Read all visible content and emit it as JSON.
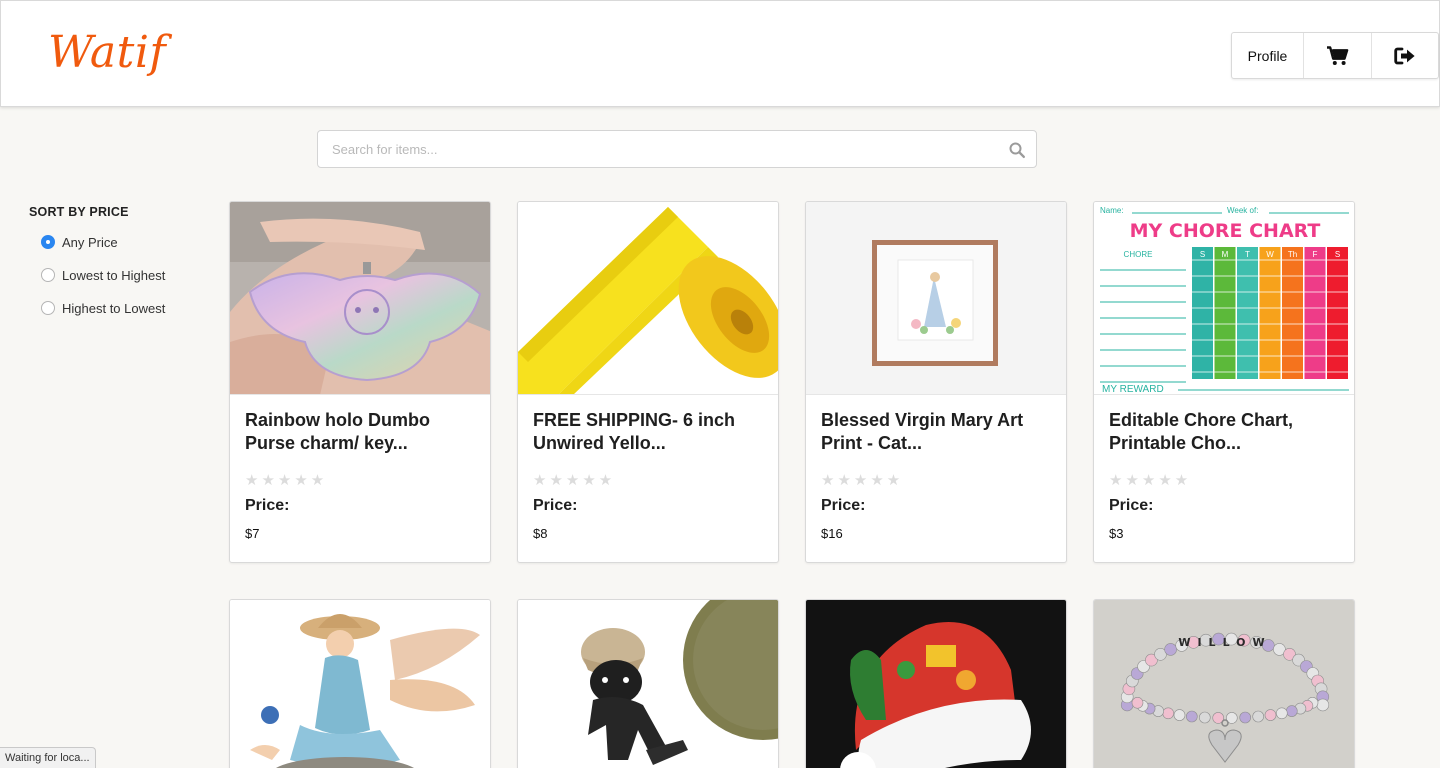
{
  "header": {
    "logo": "Watif",
    "nav": {
      "profile_label": "Profile",
      "cart_icon": "cart-icon",
      "logout_icon": "sign-out-icon"
    }
  },
  "search": {
    "placeholder": "Search for items...",
    "value": "",
    "icon": "search-icon"
  },
  "sidebar": {
    "title": "SORT BY PRICE",
    "options": [
      {
        "label": "Any Price",
        "selected": true
      },
      {
        "label": "Lowest to Highest",
        "selected": false
      },
      {
        "label": "Highest to Lowest",
        "selected": false
      }
    ]
  },
  "products": [
    {
      "title": "Rainbow holo Dumbo Purse charm/ key...",
      "rating": 0,
      "price_label": "Price:",
      "price": "$7"
    },
    {
      "title": "FREE SHIPPING- 6 inch Unwired Yello...",
      "rating": 0,
      "price_label": "Price:",
      "price": "$8"
    },
    {
      "title": "Blessed Virgin Mary Art Print - Cat...",
      "rating": 0,
      "price_label": "Price:",
      "price": "$16"
    },
    {
      "title": "Editable Chore Chart, Printable Cho...",
      "rating": 0,
      "price_label": "Price:",
      "price": "$3"
    }
  ],
  "products_row2": [
    {
      "image": "fairy figurine"
    },
    {
      "image": "crochet doll"
    },
    {
      "image": "santa hat"
    },
    {
      "image": "name bracelet"
    }
  ],
  "chore_chart": {
    "name_label": "Name:",
    "week_label": "Week of:",
    "heading": "MY CHORE CHART",
    "chore_label": "CHORE",
    "days": [
      "S",
      "M",
      "T",
      "W",
      "Th",
      "F",
      "S"
    ],
    "reward_label": "MY REWARD"
  },
  "bracelet_text": "WILLOW",
  "colors": {
    "accent": "#f05a0e",
    "radio": "#2a86f0"
  },
  "status_bar": "Waiting for loca..."
}
